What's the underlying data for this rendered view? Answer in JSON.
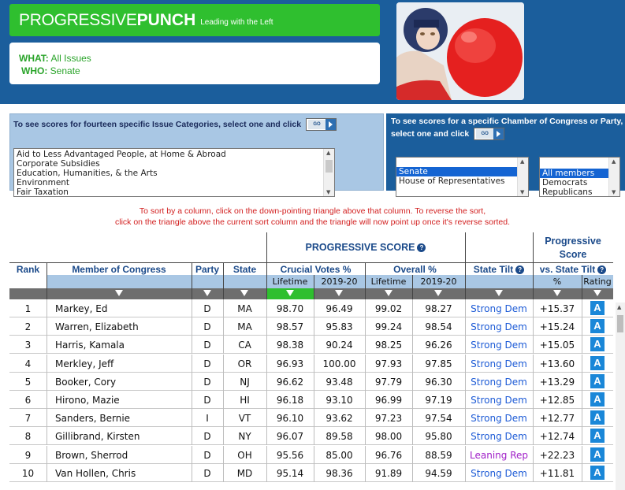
{
  "header": {
    "logo_prog": "PROGRESSIVE",
    "logo_punch": "PUNCH",
    "logo_tag": "Leading with the Left",
    "what_label": "WHAT:",
    "what_value": "All Issues",
    "who_label": "WHO:",
    "who_value": "Senate"
  },
  "issue_selector": {
    "prompt": "To see scores for fourteen specific Issue Categories, select one and click",
    "go_label": "GO",
    "options": [
      "Aid to Less Advantaged People, at Home & Abroad",
      "Corporate Subsidies",
      "Education, Humanities, & the Arts",
      "Environment",
      "Fair Taxation"
    ]
  },
  "chamber_selector": {
    "prompt": "To see scores for a specific Chamber of Congress or Party, select one and click",
    "go_label": "GO",
    "chambers": [
      "Senate",
      "House of Representatives"
    ],
    "selected_chamber": "Senate",
    "members": [
      "All members",
      "Democrats",
      "Republicans"
    ],
    "selected_member": "All members"
  },
  "sort_note": {
    "line1": "To sort by a column, click on the down-pointing triangle above that column. To reverse the sort,",
    "line2": "click on the triangle above the current sort column and the triangle will now point up once it's reverse sorted."
  },
  "table": {
    "group_header": "PROGRESSIVE SCORE",
    "prog_score_header1": "Progressive",
    "prog_score_header2": "Score",
    "columns": {
      "rank": "Rank",
      "member": "Member of Congress",
      "party": "Party",
      "state": "State",
      "crucial": "Crucial Votes %",
      "overall": "Overall %",
      "tilt": "State Tilt",
      "vs_tilt": "vs. State Tilt"
    },
    "subcolumns": {
      "lifetime": "Lifetime",
      "period": "2019-20",
      "pct": "%",
      "rating": "Rating"
    },
    "rows": [
      {
        "rank": "1",
        "name": "Markey, Ed",
        "party": "D",
        "state": "MA",
        "crucial_life": "98.70",
        "crucial_period": "96.49",
        "overall_life": "99.02",
        "overall_period": "98.27",
        "tilt": "Strong Dem",
        "vs": "+15.37",
        "rating": "A"
      },
      {
        "rank": "2",
        "name": "Warren, Elizabeth",
        "party": "D",
        "state": "MA",
        "crucial_life": "98.57",
        "crucial_period": "95.83",
        "overall_life": "99.24",
        "overall_period": "98.54",
        "tilt": "Strong Dem",
        "vs": "+15.24",
        "rating": "A"
      },
      {
        "rank": "3",
        "name": "Harris, Kamala",
        "party": "D",
        "state": "CA",
        "crucial_life": "98.38",
        "crucial_period": "90.24",
        "overall_life": "98.25",
        "overall_period": "96.26",
        "tilt": "Strong Dem",
        "vs": "+15.05",
        "rating": "A"
      },
      {
        "rank": "4",
        "name": "Merkley, Jeff",
        "party": "D",
        "state": "OR",
        "crucial_life": "96.93",
        "crucial_period": "100.00",
        "overall_life": "97.93",
        "overall_period": "97.85",
        "tilt": "Strong Dem",
        "vs": "+13.60",
        "rating": "A"
      },
      {
        "rank": "5",
        "name": "Booker, Cory",
        "party": "D",
        "state": "NJ",
        "crucial_life": "96.62",
        "crucial_period": "93.48",
        "overall_life": "97.79",
        "overall_period": "96.30",
        "tilt": "Strong Dem",
        "vs": "+13.29",
        "rating": "A"
      },
      {
        "rank": "6",
        "name": "Hirono, Mazie",
        "party": "D",
        "state": "HI",
        "crucial_life": "96.18",
        "crucial_period": "93.10",
        "overall_life": "96.99",
        "overall_period": "97.19",
        "tilt": "Strong Dem",
        "vs": "+12.85",
        "rating": "A"
      },
      {
        "rank": "7",
        "name": "Sanders, Bernie",
        "party": "I",
        "state": "VT",
        "crucial_life": "96.10",
        "crucial_period": "93.62",
        "overall_life": "97.23",
        "overall_period": "97.54",
        "tilt": "Strong Dem",
        "vs": "+12.77",
        "rating": "A"
      },
      {
        "rank": "8",
        "name": "Gillibrand, Kirsten",
        "party": "D",
        "state": "NY",
        "crucial_life": "96.07",
        "crucial_period": "89.58",
        "overall_life": "98.00",
        "overall_period": "95.80",
        "tilt": "Strong Dem",
        "vs": "+12.74",
        "rating": "A"
      },
      {
        "rank": "9",
        "name": "Brown, Sherrod",
        "party": "D",
        "state": "OH",
        "crucial_life": "95.56",
        "crucial_period": "85.00",
        "overall_life": "96.76",
        "overall_period": "88.59",
        "tilt": "Leaning Rep",
        "vs": "+22.23",
        "rating": "A"
      },
      {
        "rank": "10",
        "name": "Van Hollen, Chris",
        "party": "D",
        "state": "MD",
        "crucial_life": "95.14",
        "crucial_period": "98.36",
        "overall_life": "91.89",
        "overall_period": "94.59",
        "tilt": "Strong Dem",
        "vs": "+11.81",
        "rating": "A"
      }
    ]
  },
  "colors": {
    "brand_green": "#2fbf2f",
    "header_blue": "#1b5e9c",
    "subheader_blue": "#a9c7e4",
    "strong_dem": "#1d5bd6",
    "leaning_rep": "#a020c8",
    "rating_blue": "#1a87d8",
    "sort_note_red": "#d21f1f"
  }
}
